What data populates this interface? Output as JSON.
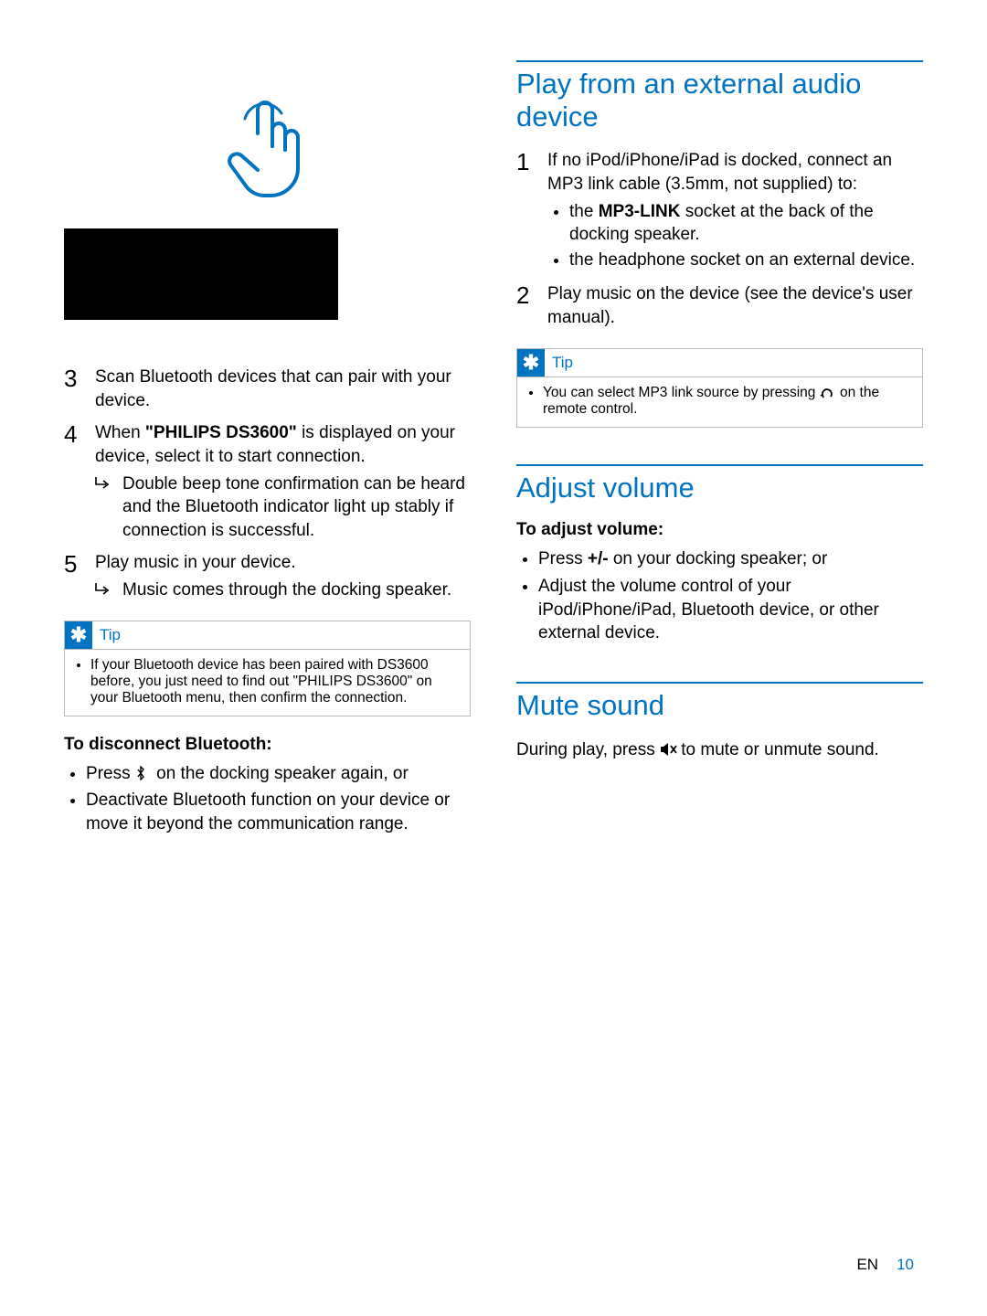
{
  "left": {
    "steps": {
      "s3": {
        "num": "3",
        "text": "Scan Bluetooth devices that can pair with your device."
      },
      "s4": {
        "num": "4",
        "text_pre": "When ",
        "text_bold": "\"PHILIPS DS3600\"",
        "text_post": " is displayed on your device, select it to start connection.",
        "arrow": "Double beep tone confirmation can be heard and the Bluetooth indicator light up stably if connection is successful."
      },
      "s5": {
        "num": "5",
        "text": "Play music in your device.",
        "arrow": "Music comes through the docking speaker."
      }
    },
    "tip": {
      "label": "Tip",
      "body": "If your Bluetooth device has been paired with DS3600 before, you just need to find out \"PHILIPS DS3600\" on your Bluetooth menu, then confirm the connection."
    },
    "disconnect": {
      "heading": "To disconnect Bluetooth:",
      "b1_pre": "Press ",
      "b1_post": " on the docking speaker again, or",
      "b2": "Deactivate Bluetooth function on your device or move it beyond the communication range."
    }
  },
  "right": {
    "play_ext": {
      "title": "Play from an external audio device",
      "s1": {
        "num": "1",
        "text": "If no iPod/iPhone/iPad is docked, connect an MP3 link cable (3.5mm, not supplied) to:",
        "sub1_pre": "the ",
        "sub1_bold": "MP3-LINK",
        "sub1_post": " socket at the back of the docking speaker.",
        "sub2": "the headphone socket on an external device."
      },
      "s2": {
        "num": "2",
        "text": "Play music on the device (see the device's user manual)."
      },
      "tip": {
        "label": "Tip",
        "body_pre": "You can select MP3 link source by pressing ",
        "body_post": " on the remote control."
      }
    },
    "adjust": {
      "title": "Adjust volume",
      "heading": "To adjust volume:",
      "b1_pre": "Press ",
      "b1_bold": "+/-",
      "b1_post": " on your docking speaker; or",
      "b2": "Adjust the volume control of your iPod/iPhone/iPad, Bluetooth device, or other external device."
    },
    "mute": {
      "title": "Mute sound",
      "body_pre": "During play, press ",
      "body_post": " to mute or unmute sound."
    }
  },
  "footer": {
    "lang": "EN",
    "page": "10"
  }
}
